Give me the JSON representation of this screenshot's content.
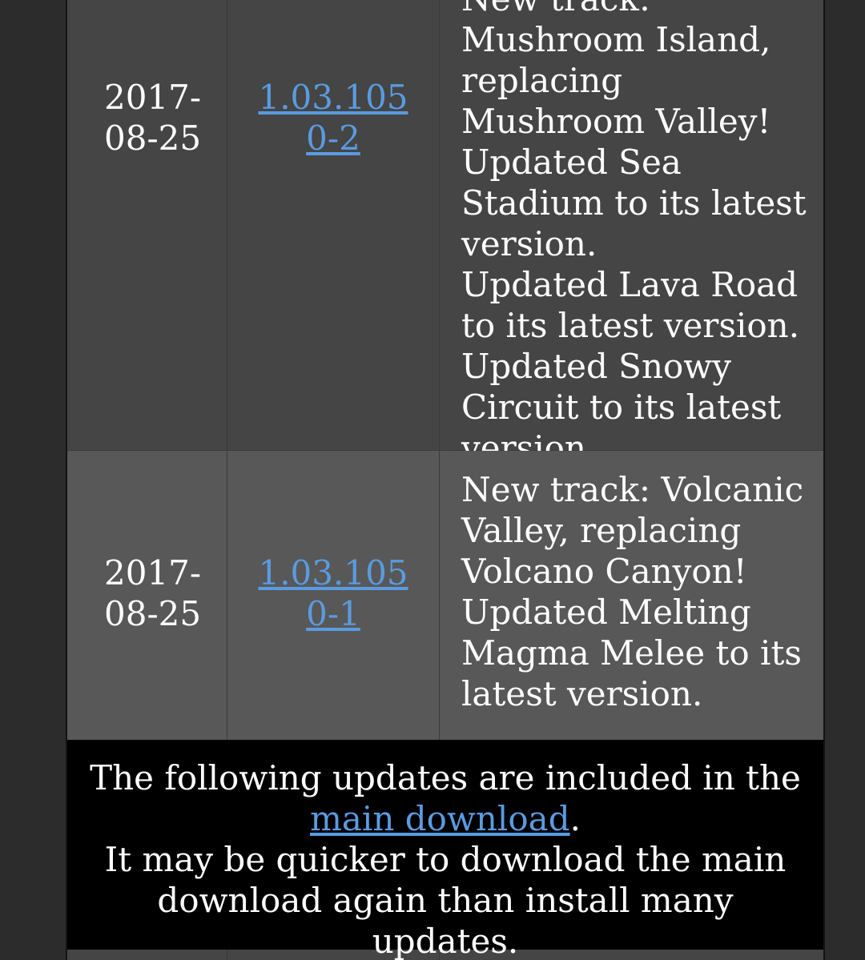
{
  "rows": [
    {
      "date": "2017-08-25",
      "version": "1.03.1050-2",
      "notes": [
        "New track: Mushroom Island, replacing Mushroom Valley!",
        "Updated Sea Stadium to its latest version.",
        "Updated Lava Road to its latest version.",
        "Updated Snowy Circuit to its latest version."
      ]
    },
    {
      "date": "2017-08-25",
      "version": "1.03.1050-1",
      "notes": [
        "New track: Volcanic Valley, replacing Volcano Canyon!",
        "Updated Melting Magma Melee to its latest version."
      ]
    }
  ],
  "notice": {
    "line1_prefix": "The following updates are included in the",
    "link_text": "main download",
    "line1_suffix": ".",
    "line2": "It may be quicker to download the main download again than install many updates."
  },
  "colors": {
    "link": "#5a9be0",
    "row_dark": "#454545",
    "row_light": "#585858",
    "notice_bg": "#000000"
  }
}
